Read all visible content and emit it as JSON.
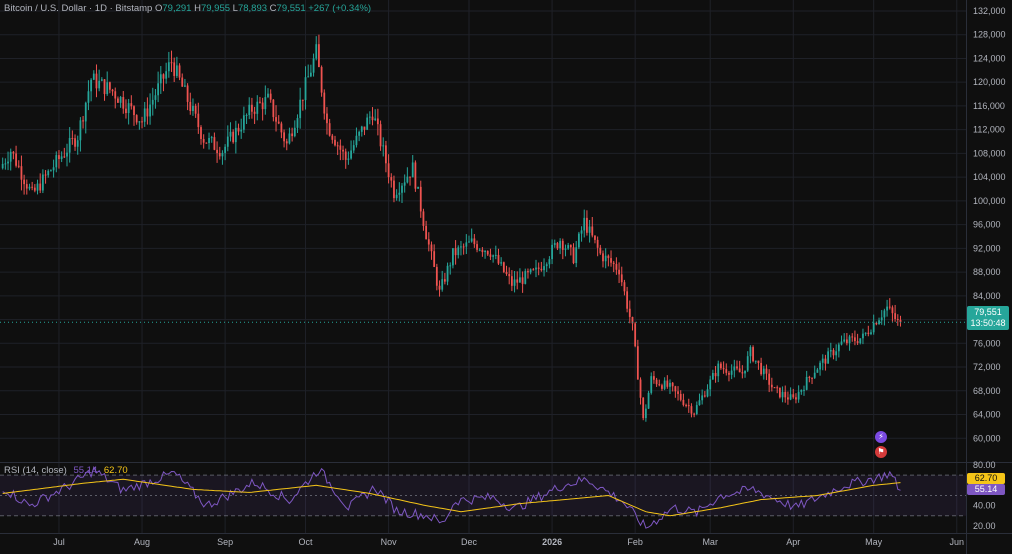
{
  "header": {
    "symbol": "Bitcoin / U.S. Dollar · 1D · Bitstamp",
    "open_label": "O",
    "open": "79,291",
    "high_label": "H",
    "high": "79,955",
    "low_label": "L",
    "low": "78,893",
    "close_label": "C",
    "close": "79,551",
    "change": "+267 (+0.34%)"
  },
  "price_badge": {
    "price": "79,551",
    "countdown": "13:50:48"
  },
  "rsi": {
    "title": "RSI (14, close)",
    "value": "55.14",
    "ma_value": "62.70"
  },
  "events": {
    "icon_a": "lightning-icon",
    "icon_b": "flag-icon"
  },
  "colors": {
    "up": "#26a69a",
    "down": "#ef5350",
    "rsi_line": "#7e57c2",
    "rsi_ma": "#f5c518",
    "background": "#0f0f0f"
  },
  "chart_data": [
    {
      "type": "candlestick",
      "series_unit": "USD",
      "y_ticks": [
        60000,
        64000,
        68000,
        72000,
        76000,
        80000,
        84000,
        88000,
        92000,
        96000,
        100000,
        104000,
        108000,
        112000,
        116000,
        120000,
        124000,
        128000,
        132000
      ],
      "y_tick_labels": [
        "60,000",
        "64,000",
        "68,000",
        "72,000",
        "76,000",
        "80,000",
        "84,000",
        "88,000",
        "92,000",
        "96,000",
        "100,000",
        "104,000",
        "108,000",
        "112,000",
        "116,000",
        "120,000",
        "124,000",
        "128,000",
        "132,000"
      ],
      "x_labels": [
        "Jul",
        "Aug",
        "Sep",
        "Oct",
        "Nov",
        "Dec",
        "2026",
        "Feb",
        "Mar",
        "Apr",
        "May",
        "Jun"
      ],
      "x_label_bold": "2026",
      "ylim": [
        56000,
        132500
      ],
      "last_price": 79551,
      "path_points": [
        {
          "x": "Jun 10",
          "y": 105500
        },
        {
          "x": "Jun 14",
          "y": 108500
        },
        {
          "x": "Jun 22",
          "y": 101000
        },
        {
          "x": "Jul 1",
          "y": 106500
        },
        {
          "x": "Jul 9",
          "y": 111000
        },
        {
          "x": "Jul 14",
          "y": 120500
        },
        {
          "x": "Jul 22",
          "y": 118500
        },
        {
          "x": "Aug 2",
          "y": 113500
        },
        {
          "x": "Aug 13",
          "y": 123500
        },
        {
          "x": "Aug 25",
          "y": 110500
        },
        {
          "x": "Sep 1",
          "y": 108500
        },
        {
          "x": "Sep 12",
          "y": 115500
        },
        {
          "x": "Sep 18",
          "y": 117000
        },
        {
          "x": "Sep 25",
          "y": 109500
        },
        {
          "x": "Oct 6",
          "y": 125000
        },
        {
          "x": "Oct 10",
          "y": 113000
        },
        {
          "x": "Oct 17",
          "y": 107000
        },
        {
          "x": "Oct 27",
          "y": 115000
        },
        {
          "x": "Nov 4",
          "y": 101500
        },
        {
          "x": "Nov 11",
          "y": 105500
        },
        {
          "x": "Nov 16",
          "y": 94500
        },
        {
          "x": "Nov 21",
          "y": 84500
        },
        {
          "x": "Nov 26",
          "y": 91000
        },
        {
          "x": "Dec 3",
          "y": 93000
        },
        {
          "x": "Dec 10",
          "y": 91500
        },
        {
          "x": "Dec 18",
          "y": 86000
        },
        {
          "x": "Dec 27",
          "y": 88000
        },
        {
          "x": "Jan 5",
          "y": 93500
        },
        {
          "x": "Jan 10",
          "y": 90500
        },
        {
          "x": "Jan 14",
          "y": 96500
        },
        {
          "x": "Jan 20",
          "y": 91000
        },
        {
          "x": "Jan 27",
          "y": 88500
        },
        {
          "x": "Feb 1",
          "y": 78500
        },
        {
          "x": "Feb 5",
          "y": 63000
        },
        {
          "x": "Feb 8",
          "y": 70000
        },
        {
          "x": "Feb 15",
          "y": 68500
        },
        {
          "x": "Feb 24",
          "y": 64500
        },
        {
          "x": "Mar 5",
          "y": 72000
        },
        {
          "x": "Mar 14",
          "y": 71000
        },
        {
          "x": "Mar 17",
          "y": 74500
        },
        {
          "x": "Mar 26",
          "y": 68000
        },
        {
          "x": "Apr 2",
          "y": 66500
        },
        {
          "x": "Apr 10",
          "y": 71500
        },
        {
          "x": "Apr 20",
          "y": 76000
        },
        {
          "x": "Apr 28",
          "y": 77000
        },
        {
          "x": "May 3",
          "y": 80000
        },
        {
          "x": "May 7",
          "y": 82000
        },
        {
          "x": "May 11",
          "y": 79551
        }
      ]
    },
    {
      "type": "line",
      "y_ticks": [
        20,
        40,
        60,
        80
      ],
      "y_tick_labels": [
        "20.00",
        "40.00",
        "60.00",
        "80.00"
      ],
      "bands": [
        30,
        50,
        70
      ],
      "ylim": [
        16,
        82
      ],
      "x_labels": [
        "Jul",
        "Aug",
        "Sep",
        "Oct",
        "Nov",
        "Dec",
        "2026",
        "Feb",
        "Mar",
        "Apr",
        "May",
        "Jun"
      ],
      "ma_path": [
        {
          "x": "Jun 10",
          "y": 52
        },
        {
          "x": "Jul 10",
          "y": 62
        },
        {
          "x": "Jul 25",
          "y": 66
        },
        {
          "x": "Aug 20",
          "y": 56
        },
        {
          "x": "Sep 10",
          "y": 53
        },
        {
          "x": "Oct 5",
          "y": 60
        },
        {
          "x": "Oct 25",
          "y": 52
        },
        {
          "x": "Nov 15",
          "y": 40
        },
        {
          "x": "Nov 28",
          "y": 34
        },
        {
          "x": "Dec 20",
          "y": 42
        },
        {
          "x": "Jan 10",
          "y": 47
        },
        {
          "x": "Jan 22",
          "y": 50
        },
        {
          "x": "Feb 5",
          "y": 34
        },
        {
          "x": "Feb 14",
          "y": 30
        },
        {
          "x": "Mar 5",
          "y": 38
        },
        {
          "x": "Mar 20",
          "y": 46
        },
        {
          "x": "Apr 10",
          "y": 50
        },
        {
          "x": "May 1",
          "y": 60
        },
        {
          "x": "May 11",
          "y": 62.7
        }
      ],
      "rsi_path": [
        {
          "x": "Jun 10",
          "y": 58
        },
        {
          "x": "Jun 20",
          "y": 40
        },
        {
          "x": "Jul 5",
          "y": 60
        },
        {
          "x": "Jul 14",
          "y": 75
        },
        {
          "x": "Jul 25",
          "y": 55
        },
        {
          "x": "Aug 13",
          "y": 72
        },
        {
          "x": "Aug 25",
          "y": 40
        },
        {
          "x": "Sep 12",
          "y": 63
        },
        {
          "x": "Sep 25",
          "y": 45
        },
        {
          "x": "Oct 6",
          "y": 76
        },
        {
          "x": "Oct 17",
          "y": 38
        },
        {
          "x": "Oct 27",
          "y": 58
        },
        {
          "x": "Nov 4",
          "y": 35
        },
        {
          "x": "Nov 16",
          "y": 30
        },
        {
          "x": "Nov 21",
          "y": 22
        },
        {
          "x": "Nov 26",
          "y": 45
        },
        {
          "x": "Dec 10",
          "y": 48
        },
        {
          "x": "Dec 18",
          "y": 37
        },
        {
          "x": "Jan 5",
          "y": 60
        },
        {
          "x": "Jan 14",
          "y": 66
        },
        {
          "x": "Jan 27",
          "y": 45
        },
        {
          "x": "Feb 5",
          "y": 18
        },
        {
          "x": "Feb 15",
          "y": 38
        },
        {
          "x": "Feb 24",
          "y": 33
        },
        {
          "x": "Mar 5",
          "y": 50
        },
        {
          "x": "Mar 17",
          "y": 56
        },
        {
          "x": "Apr 2",
          "y": 38
        },
        {
          "x": "Apr 20",
          "y": 60
        },
        {
          "x": "May 3",
          "y": 68
        },
        {
          "x": "May 7",
          "y": 72
        },
        {
          "x": "May 11",
          "y": 55.14
        }
      ]
    }
  ]
}
